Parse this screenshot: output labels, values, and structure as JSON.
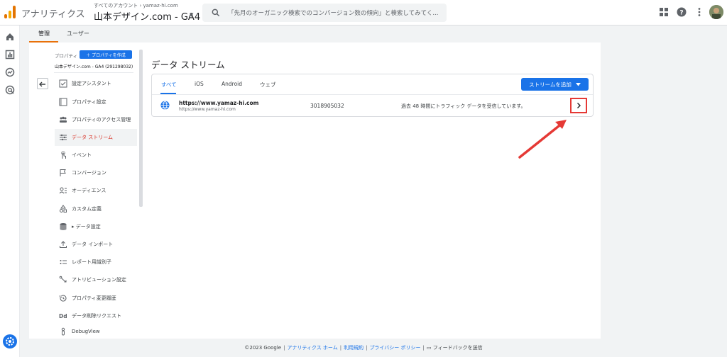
{
  "app": {
    "name": "アナリティクス",
    "account_breadcrumb": "すべてのアカウント › yamaz-hi.com",
    "property_name": "山本デザイン.com - GA4",
    "search_placeholder": "「先月のオーガニック検索でのコンバージョン数の傾向」と検索してみてく..."
  },
  "admin_tabs": [
    {
      "label": "管理",
      "active": true
    },
    {
      "label": "ユーザー",
      "active": false
    }
  ],
  "property_panel": {
    "label": "プロパティ",
    "create_button": "＋ プロパティを作成",
    "property_line": "山本デザイン.com - GA4 (291298032)"
  },
  "nav_items": [
    {
      "label": "設定アシスタント",
      "icon": "checklist-icon"
    },
    {
      "label": "プロパティ設定",
      "icon": "property-settings-icon"
    },
    {
      "label": "プロパティのアクセス管理",
      "icon": "people-icon"
    },
    {
      "label": "データ ストリーム",
      "icon": "data-stream-icon",
      "active": true
    },
    {
      "label": "イベント",
      "icon": "touch-icon"
    },
    {
      "label": "コンバージョン",
      "icon": "flag-icon"
    },
    {
      "label": "オーディエンス",
      "icon": "audience-icon"
    },
    {
      "label": "カスタム定義",
      "icon": "shapes-icon"
    },
    {
      "label": "▸ データ設定",
      "icon": "database-icon"
    },
    {
      "label": "データ インポート",
      "icon": "upload-icon"
    },
    {
      "label": "レポート用識別子",
      "icon": "identifier-icon"
    },
    {
      "label": "アトリビューション設定",
      "icon": "attribution-icon"
    },
    {
      "label": "プロパティ変更履歴",
      "icon": "history-icon"
    },
    {
      "label": "データ削除リクエスト",
      "icon": "dd-icon"
    },
    {
      "label": "DebugView",
      "icon": "debug-icon"
    }
  ],
  "data_streams": {
    "title": "データ ストリーム",
    "tabs": [
      {
        "label": "すべて",
        "active": true
      },
      {
        "label": "iOS"
      },
      {
        "label": "Android"
      },
      {
        "label": "ウェブ"
      }
    ],
    "add_button": "ストリームを追加",
    "stream": {
      "name": "https://www.yamaz-hi.com",
      "url": "https://www.yamaz-hi.com",
      "id": "3018905032",
      "status": "過去 48 時間にトラフィック データを受信しています。"
    }
  },
  "footer": {
    "copyright": "©2023 Google",
    "links": [
      "アナリティクス ホーム",
      "利用規約",
      "プライバシー ポリシー"
    ],
    "feedback": "フィードバックを送信"
  },
  "colors": {
    "accent": "#1a73e8",
    "active_nav_text": "#d93025",
    "tab_underline": "#e8710a",
    "annotation": "#e53935"
  }
}
